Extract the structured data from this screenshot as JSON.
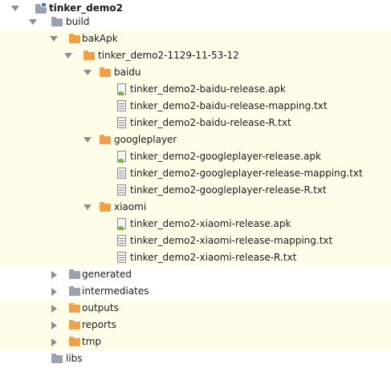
{
  "tree": {
    "root": {
      "label": "tinker_demo2"
    },
    "build": {
      "label": "build"
    },
    "bakApk": {
      "label": "bakApk"
    },
    "version": {
      "label": "tinker_demo2-1129-11-53-12"
    },
    "baidu": {
      "label": "baidu",
      "files": [
        "tinker_demo2-baidu-release.apk",
        "tinker_demo2-baidu-release-mapping.txt",
        "tinker_demo2-baidu-release-R.txt"
      ]
    },
    "googleplayer": {
      "label": "googleplayer",
      "files": [
        "tinker_demo2-googleplayer-release.apk",
        "tinker_demo2-googleplayer-release-mapping.txt",
        "tinker_demo2-googleplayer-release-R.txt"
      ]
    },
    "xiaomi": {
      "label": "xiaomi",
      "files": [
        "tinker_demo2-xiaomi-release.apk",
        "tinker_demo2-xiaomi-release-mapping.txt",
        "tinker_demo2-xiaomi-release-R.txt"
      ]
    },
    "generated": {
      "label": "generated"
    },
    "intermediates": {
      "label": "intermediates"
    },
    "outputs": {
      "label": "outputs"
    },
    "reports": {
      "label": "reports"
    },
    "tmp": {
      "label": "tmp"
    },
    "libs": {
      "label": "libs"
    }
  },
  "colors": {
    "highlight": "#fdfde8",
    "folder_gray": "#9aa3ad",
    "folder_orange": "#f0a04b",
    "android_green": "#7cb342"
  }
}
